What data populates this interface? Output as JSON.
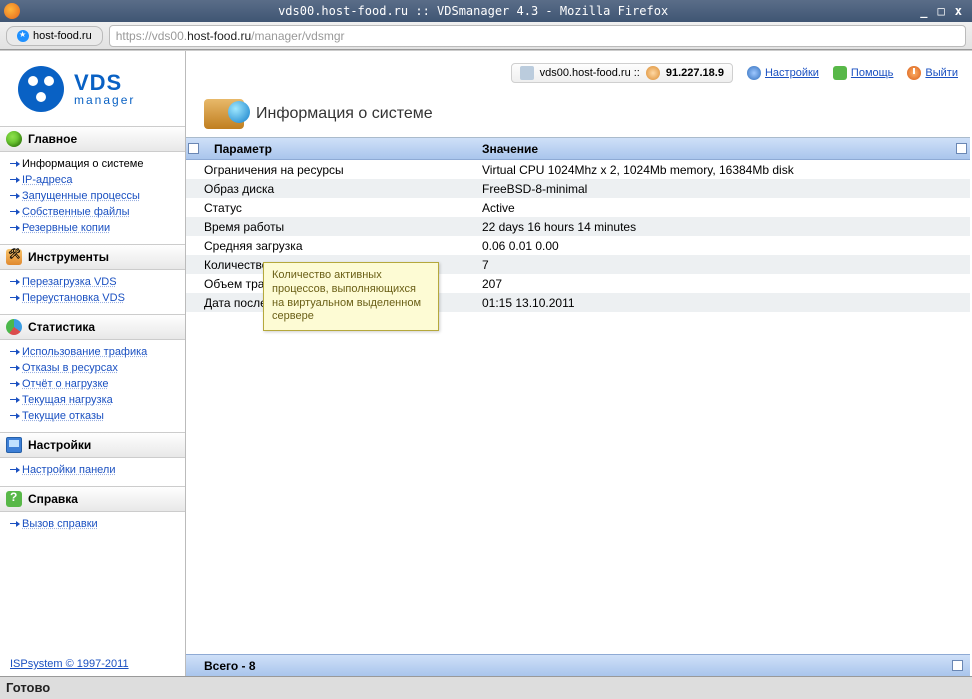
{
  "window": {
    "title": "vds00.host-food.ru :: VDSmanager 4.3 - Mozilla Firefox",
    "min": "_",
    "max": "□",
    "close": "x"
  },
  "tab": {
    "label": "host-food.ru"
  },
  "url": {
    "proto": "https://",
    "sub": "vds00.",
    "host": "host-food.ru",
    "path": "/manager/vdsmgr"
  },
  "logo": {
    "line1": "VDS",
    "line2": "manager"
  },
  "sidebar": [
    {
      "title": "Главное",
      "icon": "ico-globe",
      "items": [
        {
          "label": "Информация о системе",
          "current": true
        },
        {
          "label": "IP-адреса"
        },
        {
          "label": "Запущенные процессы"
        },
        {
          "label": "Собственные файлы"
        },
        {
          "label": "Резервные копии"
        }
      ]
    },
    {
      "title": "Инструменты",
      "icon": "ico-tools",
      "items": [
        {
          "label": "Перезагрузка VDS"
        },
        {
          "label": "Переустановка VDS"
        }
      ]
    },
    {
      "title": "Статистика",
      "icon": "ico-stats",
      "items": [
        {
          "label": "Использование трафика"
        },
        {
          "label": "Отказы в ресурсах"
        },
        {
          "label": "Отчёт о нагрузке"
        },
        {
          "label": "Текущая нагрузка"
        },
        {
          "label": "Текущие отказы"
        }
      ]
    },
    {
      "title": "Настройки",
      "icon": "ico-monitor",
      "items": [
        {
          "label": "Настройки панели"
        }
      ]
    },
    {
      "title": "Справка",
      "icon": "ico-help",
      "items": [
        {
          "label": "Вызов справки"
        }
      ]
    }
  ],
  "footer_link": "ISPsystem © 1997-2011",
  "top": {
    "host": "vds00.host-food.ru ::",
    "ip": "91.227.18.9",
    "settings": "Настройки",
    "help": "Помощь",
    "exit": "Выйти"
  },
  "page_title": "Информация о системе",
  "columns": {
    "param": "Параметр",
    "value": "Значение"
  },
  "rows": [
    {
      "p": "Ограничения на ресурсы",
      "v": "Virtual CPU 1024Mhz x 2, 1024Mb memory, 16384Mb disk"
    },
    {
      "p": "Образ диска",
      "v": "FreeBSD-8-minimal"
    },
    {
      "p": "Статус",
      "v": "Active"
    },
    {
      "p": "Время работы",
      "v": "22 days 16 hours 14 minutes"
    },
    {
      "p": "Средняя загрузка",
      "v": "0.06 0.01 0.00"
    },
    {
      "p": "Количество процессов",
      "v": "7"
    },
    {
      "p": "Объем траф",
      "v": "207"
    },
    {
      "p": "Дата послед",
      "v": "01:15 13.10.2011"
    }
  ],
  "tooltip": "Количество активных процессов, выполняющихся на виртуальном выделенном сервере",
  "total": "Всего - 8",
  "status": "Готово"
}
